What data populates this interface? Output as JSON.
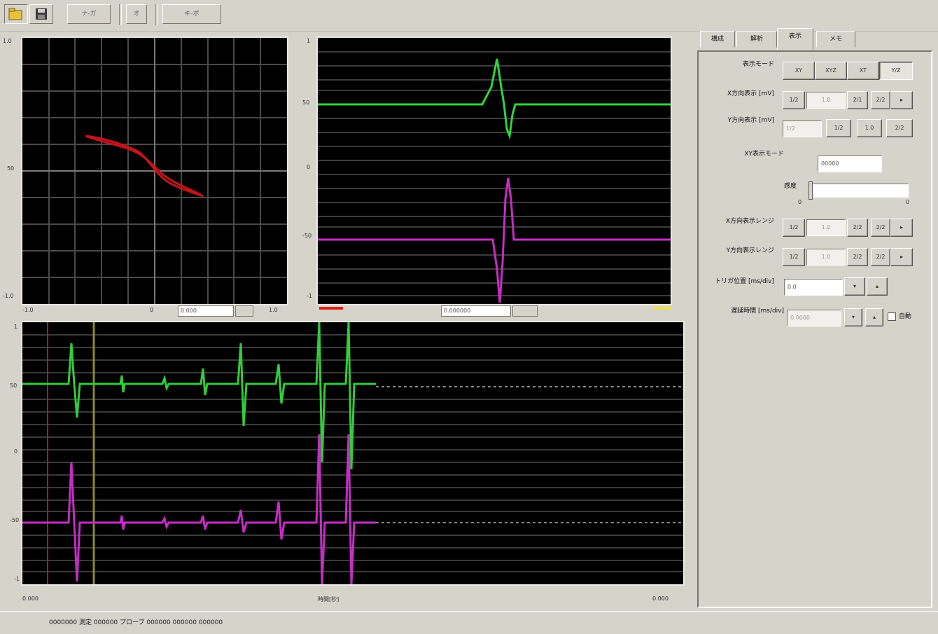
{
  "toolbar": {
    "buttons": [
      {
        "label": ""
      },
      {
        "label": ""
      },
      {
        "label": "ナ-ガ"
      },
      {
        "label": "オ"
      },
      {
        "label": "キ-ボ"
      }
    ]
  },
  "plots": {
    "topleft": {
      "y_ticks": [
        "1.0",
        "50",
        "-1.0"
      ],
      "x_ticks": [
        "-1.0",
        "0",
        "1.0"
      ],
      "readout": "0.000"
    },
    "topright": {
      "y_ticks": [
        "1",
        "50",
        "0",
        "-50",
        "-1"
      ],
      "readout": "0.000000"
    },
    "bottom": {
      "y_ticks": [
        "1",
        "50",
        "0",
        "-50",
        "-1"
      ],
      "x_left": "0.000",
      "x_center": "時間[秒]",
      "x_right": "0.000"
    }
  },
  "panel": {
    "tabs": [
      "構成",
      "解析",
      "表示",
      "メモ"
    ],
    "active_tab": 2,
    "rows": [
      {
        "label": "表示モード",
        "buttons": [
          "XY",
          "XYZ",
          "XT",
          "Y/Z"
        ]
      },
      {
        "label": "X方向表示 [mV]",
        "buttons": [
          "1/2",
          "1.0",
          "2/1",
          "2/2"
        ]
      },
      {
        "label": "Y方向表示 [mV]",
        "buttons": [
          "1/2",
          "1/2",
          "1.0",
          "2/2"
        ]
      },
      {
        "label": "X方向表示レンジ",
        "buttons": [
          "1/2",
          "1.0",
          "2/2",
          "2/2"
        ]
      },
      {
        "label": "Y方向表示レンジ",
        "buttons": [
          "1/2",
          "1.0",
          "2/2",
          "2/2"
        ]
      }
    ],
    "xy_mode_label": "XY表示モード",
    "xy_mode_value": "00000",
    "gain_label": "感度",
    "slider_min": "0",
    "slider_max": "0",
    "trigger_label": "トリガ位置 [ms/div]",
    "trigger_value": "0.0",
    "pretrigger_label": "遅延時間 [ms/div]",
    "pretrigger_value": "0.0000",
    "pretrigger_suffix": "自動"
  },
  "status": {
    "text": "0000000 測定 000000 プローブ 000000 000000 000000"
  }
}
